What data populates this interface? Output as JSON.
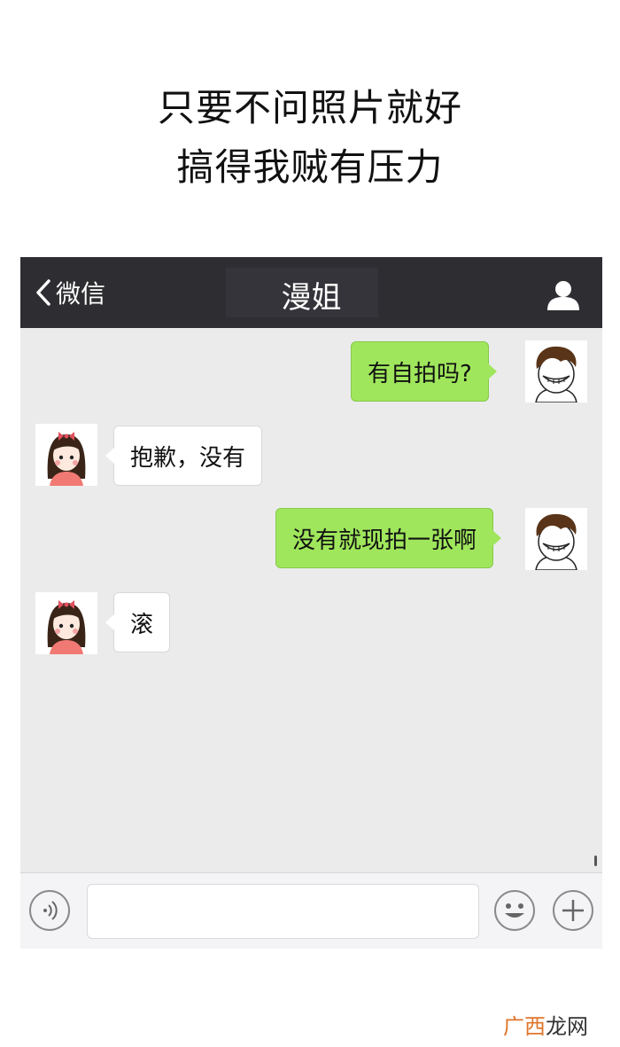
{
  "caption": {
    "line1": "只要不问照片就好",
    "line2": "搞得我贼有压力"
  },
  "header": {
    "back_label": "微信",
    "title": "漫姐",
    "profile_icon": "person-icon"
  },
  "messages": [
    {
      "side": "right",
      "sender": "boy",
      "text": "有自拍吗?"
    },
    {
      "side": "left",
      "sender": "girl",
      "text": "抱歉，没有"
    },
    {
      "side": "right",
      "sender": "boy",
      "text": "没有就现拍一张啊"
    },
    {
      "side": "left",
      "sender": "girl",
      "text": "滚"
    }
  ],
  "input_bar": {
    "voice_icon": "voice-icon",
    "emoji_icon": "emoji-icon",
    "plus_icon": "plus-icon",
    "value": "",
    "placeholder": ""
  },
  "watermark": {
    "part1": "广西",
    "part2": "龙网"
  },
  "colors": {
    "navbar": "#2e2e32",
    "chat_background": "#ebebeb",
    "outgoing_bubble": "#9fe65c",
    "incoming_bubble": "#ffffff",
    "girl_shirt": "#f07a73",
    "girl_bow": "#e0505e"
  }
}
